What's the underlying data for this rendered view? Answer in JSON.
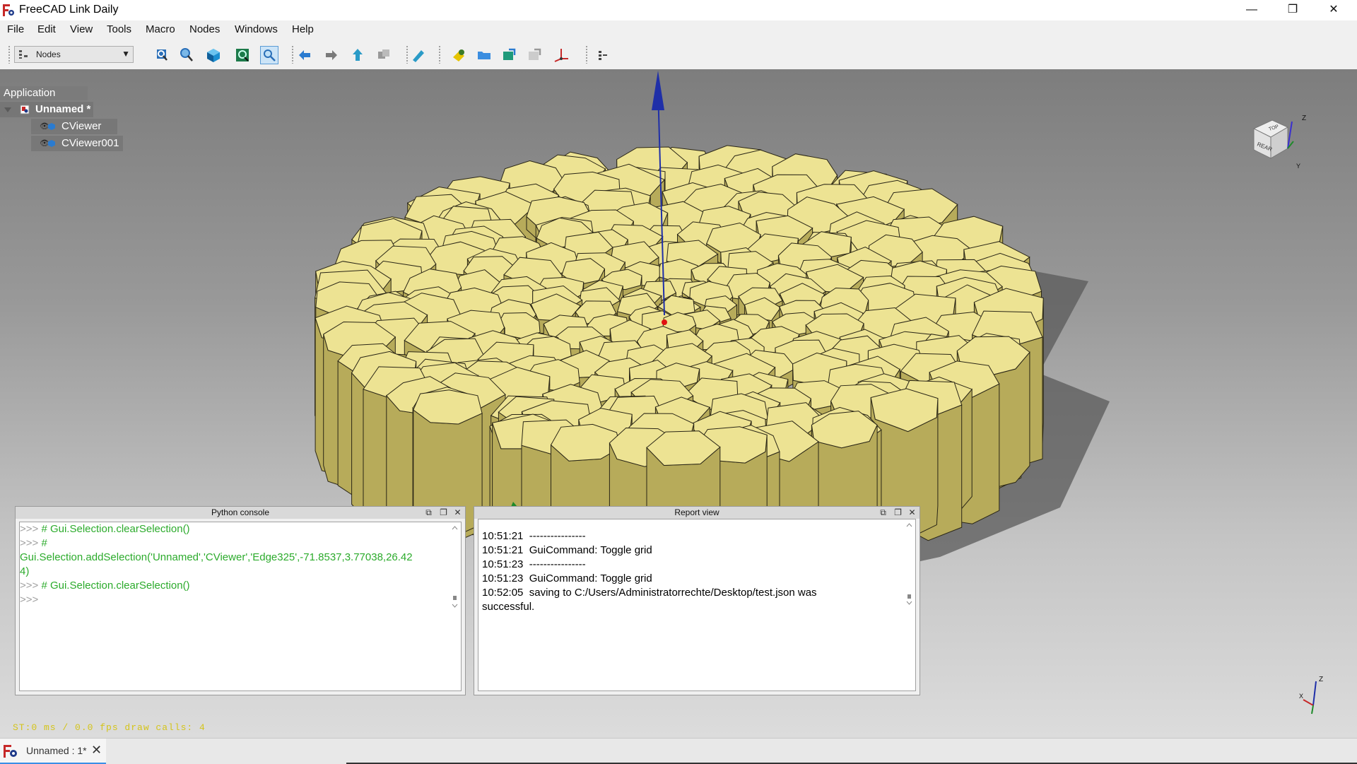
{
  "window": {
    "title": "FreeCAD Link Daily",
    "minimize": "—",
    "maximize": "❐",
    "close": "✕"
  },
  "menu": [
    "File",
    "Edit",
    "View",
    "Tools",
    "Macro",
    "Nodes",
    "Windows",
    "Help"
  ],
  "toolbar": {
    "workbench": "Nodes",
    "tool_icons": [
      "fit-all-icon",
      "fit-selection-icon",
      "isometric-view-icon",
      "fit-screen-icon",
      "selection-zoom-icon",
      "back-arrow-icon",
      "forward-arrow-icon",
      "up-arrow-icon",
      "link-icon",
      "measure-icon",
      "macro-icon",
      "folder-icon",
      "open-icon",
      "redo-icon",
      "axis-icon",
      "toggle-icon"
    ]
  },
  "tree": {
    "header": "Application",
    "document": "Unnamed *",
    "children": [
      "CViewer",
      "CViewer001"
    ]
  },
  "navcube": {
    "top": "TOP",
    "rear": "REAR",
    "z": "Z",
    "y": "Y"
  },
  "mini_axis": {
    "z": "Z",
    "x": "X"
  },
  "python_console": {
    "title": "Python console",
    "lines": [
      {
        "prompt": ">>> ",
        "text": "# Gui.Selection.clearSelection()"
      },
      {
        "prompt": ">>> ",
        "text": "#"
      },
      {
        "prompt": "",
        "text": "Gui.Selection.addSelection('Unnamed','CViewer','Edge325',-71.8537,3.77038,26.42"
      },
      {
        "prompt": "",
        "text": "4)"
      },
      {
        "prompt": ">>> ",
        "text": "# Gui.Selection.clearSelection()"
      },
      {
        "prompt": ">>> ",
        "text": ""
      }
    ]
  },
  "report_view": {
    "title": "Report view",
    "lines": [
      "10:51:21  ----------------",
      "10:51:21  GuiCommand: Toggle grid",
      "10:51:23  ----------------",
      "10:51:23  GuiCommand: Toggle grid",
      "10:52:05  saving to C:/Users/Administratorrechte/Desktop/test.json was",
      "successful."
    ]
  },
  "status_overlay": "ST:0 ms / 0.0 fps  draw calls: 4",
  "doc_tab": {
    "label": "Unnamed : 1*",
    "close": "✕"
  },
  "colors": {
    "console_text": "#2cab2c",
    "prism_fill": "#ede393",
    "accent": "#3a8ee6"
  }
}
